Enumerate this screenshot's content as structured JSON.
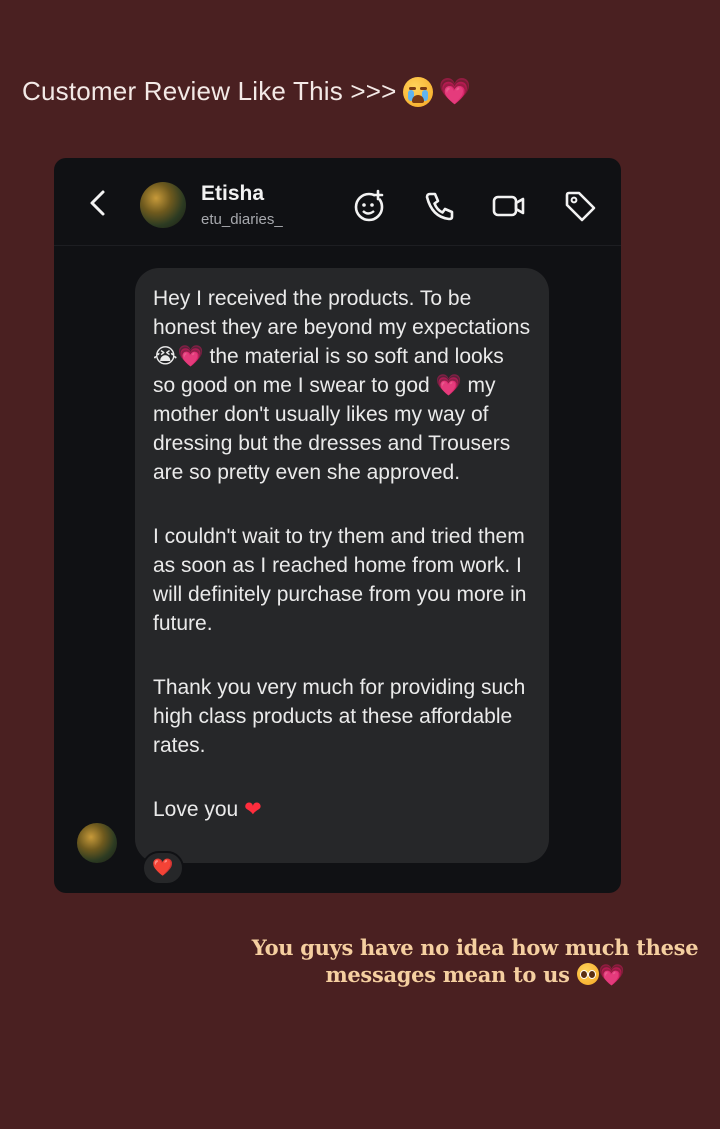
{
  "story": {
    "title": "Customer Review Like This >>>",
    "title_emojis": [
      "loudly-crying-face",
      "growing-heart"
    ],
    "caption_line1": "You guys have no idea how much these",
    "caption_line2": "messages mean to us",
    "caption_emojis": [
      "pleading-face",
      "growing-heart"
    ],
    "colors": {
      "background": "#4a2021",
      "caption": "#f5cfa0"
    }
  },
  "header": {
    "name": "Etisha",
    "handle": "etu_diaries_",
    "icons": [
      "back-chevron-icon",
      "sticker-icon",
      "phone-icon",
      "video-icon",
      "tag-icon"
    ]
  },
  "message": {
    "p1_a": "Hey I received the products. To be honest they are beyond my expectations",
    "p1_b": "the material is so soft and looks so good on me I swear to god",
    "p1_c": "my mother don't usually likes my way of dressing but the dresses and Trousers are so pretty even she approved.",
    "p2": "I couldn't wait to try them and tried them as soon as I reached home from work. I will definitely purchase from you more in future.",
    "p3": "Thank you very much for providing such high class products at these affordable rates.",
    "p4": "Love you",
    "reaction": "❤️"
  }
}
